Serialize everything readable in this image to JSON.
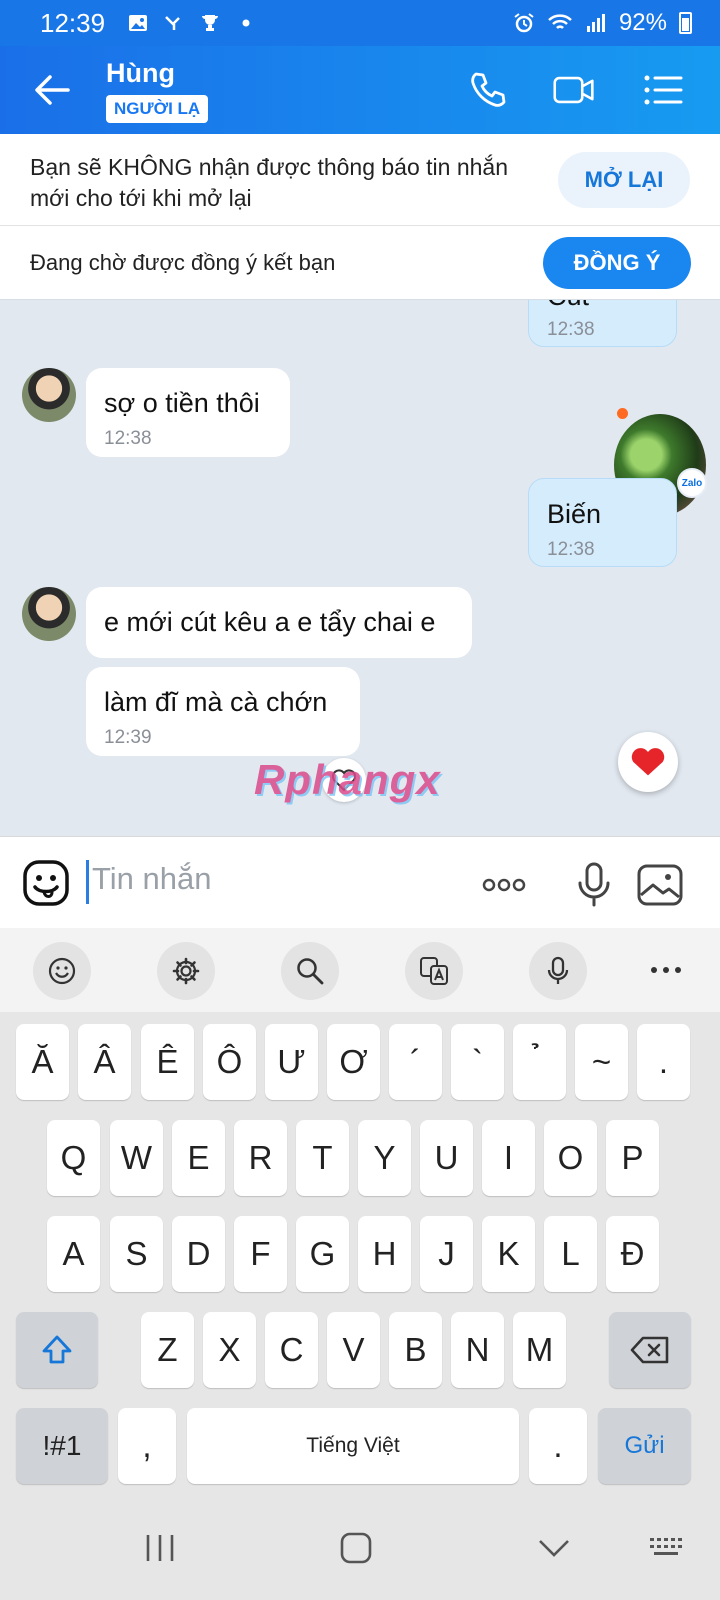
{
  "status_bar": {
    "time": "12:39",
    "battery": "92%"
  },
  "header": {
    "contact_name": "Hùng",
    "badge": "NGƯỜI LẠ"
  },
  "notice": {
    "text": "Bạn sẽ KHÔNG nhận được thông báo tin nhắn mới cho tới khi mở lại",
    "button": "MỞ LẠI"
  },
  "friend_request": {
    "text": "Đang chờ được đồng ý kết bạn",
    "button": "ĐỒNG Ý"
  },
  "messages": [
    {
      "dir": "out",
      "text": "Cút",
      "time": "12:38"
    },
    {
      "dir": "in",
      "text": "sợ o tiền thôi",
      "time": "12:38"
    },
    {
      "dir": "out",
      "text": "Biến",
      "time": "12:38"
    },
    {
      "dir": "in",
      "text": "e mới cút kêu a e tẩy chai e",
      "time": ""
    },
    {
      "dir": "in",
      "text": "làm đĩ mà cà chớn",
      "time": "12:39"
    }
  ],
  "zalo_badge": "Zalo",
  "watermark": "Rphangx",
  "input": {
    "placeholder": "Tin nhắn"
  },
  "keyboard": {
    "row0": [
      "Ă",
      "Â",
      "Ê",
      "Ô",
      "Ư",
      "Ơ",
      "´",
      "`",
      "̉",
      "~",
      "."
    ],
    "row1": [
      "Q",
      "W",
      "E",
      "R",
      "T",
      "Y",
      "U",
      "I",
      "O",
      "P"
    ],
    "row2": [
      "A",
      "S",
      "D",
      "F",
      "G",
      "H",
      "J",
      "K",
      "L",
      "Đ"
    ],
    "row3": [
      "Z",
      "X",
      "C",
      "V",
      "B",
      "N",
      "M"
    ],
    "symbols_key": "!#1",
    "comma_key": ",",
    "space_label": "Tiếng Việt",
    "period_key": ".",
    "send_label": "Gửi"
  },
  "colors": {
    "accent": "#1a6fe8",
    "out_bubble": "#d5ecfd",
    "chat_bg": "#e2e8f0"
  }
}
